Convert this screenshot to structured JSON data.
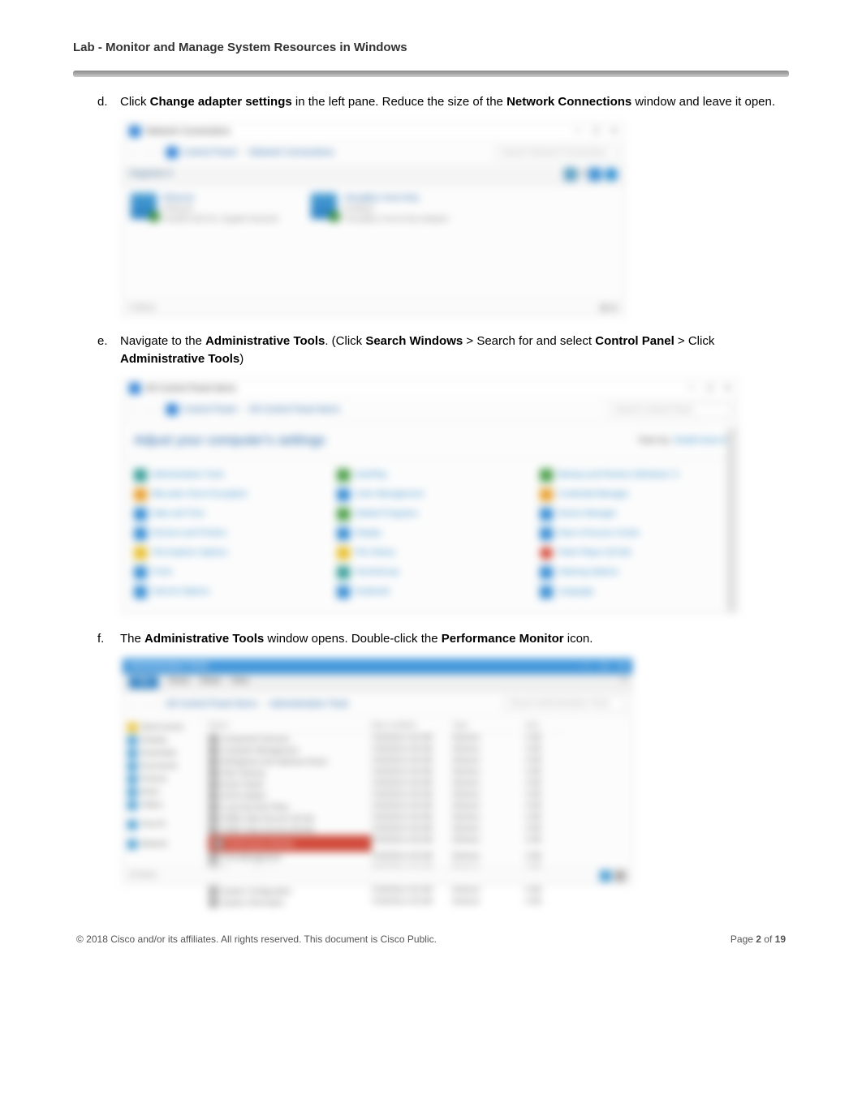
{
  "header": {
    "title": "Lab - Monitor and Manage System Resources in Windows"
  },
  "steps": {
    "d": {
      "letter": "d.",
      "text_pre": "Click ",
      "bold1": "Change adapter settings",
      "text_mid": " in the left pane. Reduce the size of the ",
      "bold2": "Network Connections",
      "text_post": " window and leave it open."
    },
    "e": {
      "letter": "e.",
      "text_pre": "Navigate  to  the ",
      "bold1": "Administrative Tools",
      "text_mid": ". (Click ",
      "bold2": "Search Windows",
      "text_mid2": " > Search for and select ",
      "bold3": "Control Panel",
      "text_mid3": " > Click ",
      "bold4": "Administrative Tools",
      "text_post": ")"
    },
    "f": {
      "letter": "f.",
      "text_pre": "The ",
      "bold1": "Administrative Tools",
      "text_mid": " window opens. Double-click the ",
      "bold2": "Performance Monitor",
      "text_post": " icon."
    }
  },
  "ss1": {
    "title": "Network Connections",
    "bc1": "Control Panel",
    "bc2": "Network Connections",
    "search_ph": "Search Network Connections",
    "toolbar": "Organize ▾",
    "adapter1_name": "Ethernet",
    "adapter1_sub1": "Network",
    "adapter1_sub2": "Intel(R) 82574L Gigabit Network",
    "adapter2_name": "VirtualBox Host-Only",
    "adapter2_sub1": "Enabled",
    "adapter2_sub2": "VirtualBox Host-Only Adapter",
    "footer_left": "2 items",
    "footer_right": "▦ ▤"
  },
  "ss2": {
    "title": "All Control Panel Items",
    "bc1": "Control Panel",
    "bc2": "All Control Panel Items",
    "search_ph": "Search Control Panel",
    "heading": "Adjust your computer's settings",
    "view_label": "View by:",
    "view_value": "Small icons ▾",
    "items": {
      "i1": "Administrative Tools",
      "i2": "AutoPlay",
      "i3": "Backup and Restore (Windows 7)",
      "i4": "BitLocker Drive Encryption",
      "i5": "Color Management",
      "i6": "Credential Manager",
      "i7": "Date and Time",
      "i8": "Default Programs",
      "i9": "Device Manager",
      "i10": "Devices and Printers",
      "i11": "Display",
      "i12": "Ease of Access Center",
      "i13": "File Explorer Options",
      "i14": "File History",
      "i15": "Flash Player (32-bit)",
      "i16": "Fonts",
      "i17": "HomeGroup",
      "i18": "Indexing Options",
      "i19": "Internet Options",
      "i20": "Keyboard",
      "i21": "Language"
    }
  },
  "ss3": {
    "title": "Administrative Tools",
    "tab_file": "File",
    "tab_home": "Home",
    "tab_share": "Share",
    "tab_view": "View",
    "bc1": "All Control Panel Items",
    "bc2": "Administrative Tools",
    "search_ph": "Search Administrative Tools",
    "nav": {
      "n1": "Quick access",
      "n2": "Desktop",
      "n3": "Downloads",
      "n4": "Documents",
      "n5": "Pictures",
      "n6": "Music",
      "n7": "Videos",
      "n8": "This PC",
      "n9": "Network"
    },
    "cols": {
      "c1": "Name",
      "c2": "Date modified",
      "c3": "Type",
      "c4": "Size"
    },
    "files": {
      "f1": "Component Services",
      "f2": "Computer Management",
      "f3": "Defragment and Optimize Drives",
      "f4": "Disk Cleanup",
      "f5": "Event Viewer",
      "f6": "iSCSI Initiator",
      "f7": "Local Security Policy",
      "f8": "ODBC Data Sources (32-bit)",
      "f9": "ODBC Data Sources (64-bit)",
      "f10": "Performance Monitor",
      "f11": "Print Management",
      "f12": "Resource Monitor",
      "f13": "Services",
      "f14": "System Configuration",
      "f15": "System Information"
    },
    "date": "7/16/2016 4:42 AM",
    "type": "Shortcut",
    "size": "2 KB",
    "footer": "20 items"
  },
  "footer": {
    "copyright": "© 2018 Cisco and/or its affiliates. All rights reserved. This document is Cisco Public.",
    "page_label": "Page ",
    "page_num": "2",
    "page_of": " of ",
    "page_total": "19"
  }
}
